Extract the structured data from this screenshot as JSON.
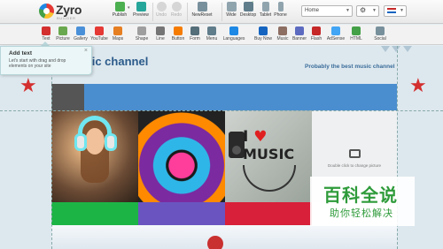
{
  "app": {
    "logo_text": "Zyro",
    "logo_sub": "BUILDER"
  },
  "toolbar": {
    "publish": "Publish",
    "preview": "Preview",
    "undo": "Undo",
    "redo": "Redo",
    "newreset": "NewReset",
    "wide": "Wide",
    "desktop": "Desktop",
    "tablet": "Tablet",
    "phone": "Phone",
    "page_select": "Home",
    "check": "✓"
  },
  "elements": [
    {
      "label": "Text",
      "color": "#d32f2f"
    },
    {
      "label": "Picture",
      "color": "#6aa84f"
    },
    {
      "label": "Gallery",
      "color": "#4a90d9"
    },
    {
      "label": "YouTube",
      "color": "#e53935"
    },
    {
      "label": "Maps",
      "color": "#e67e22"
    },
    {
      "label": "Shape",
      "color": "#9e9e9e"
    },
    {
      "label": "Line",
      "color": "#757575"
    },
    {
      "label": "Button",
      "color": "#f57c00"
    },
    {
      "label": "Form",
      "color": "#546e7a"
    },
    {
      "label": "Menu",
      "color": "#607d8b"
    },
    {
      "label": "Languages",
      "color": "#1e88e5"
    },
    {
      "label": "Buy Now",
      "color": "#1565c0"
    },
    {
      "label": "Music",
      "color": "#8d6e63"
    },
    {
      "label": "Banner",
      "color": "#5c6bc0"
    },
    {
      "label": "Flash",
      "color": "#c62828"
    },
    {
      "label": "AdSense",
      "color": "#42a5f5"
    },
    {
      "label": "HTML",
      "color": "#43a047"
    },
    {
      "label": "Social",
      "color": "#78909c"
    }
  ],
  "canvas": {
    "site_title": "music channel",
    "site_subtitle": "Probably the best music channel",
    "photo3": {
      "line1": "I",
      "heart": "♥",
      "line2": "MUSIC"
    },
    "placeholder_caption": "Double click to change picture",
    "strip_colors": [
      "#1db446",
      "#6a55c0",
      "#d8203a",
      "#ffffff"
    ]
  },
  "tooltip": {
    "title": "Add text",
    "body": "Let's start with drag and drop elements on your site",
    "close": "×"
  },
  "watermark": {
    "line1": "百科全说",
    "line2": "助你轻松解决"
  },
  "colors": {
    "accent": "#4a8ed0",
    "star": "#d32f2f",
    "title": "#2b5a8a"
  }
}
